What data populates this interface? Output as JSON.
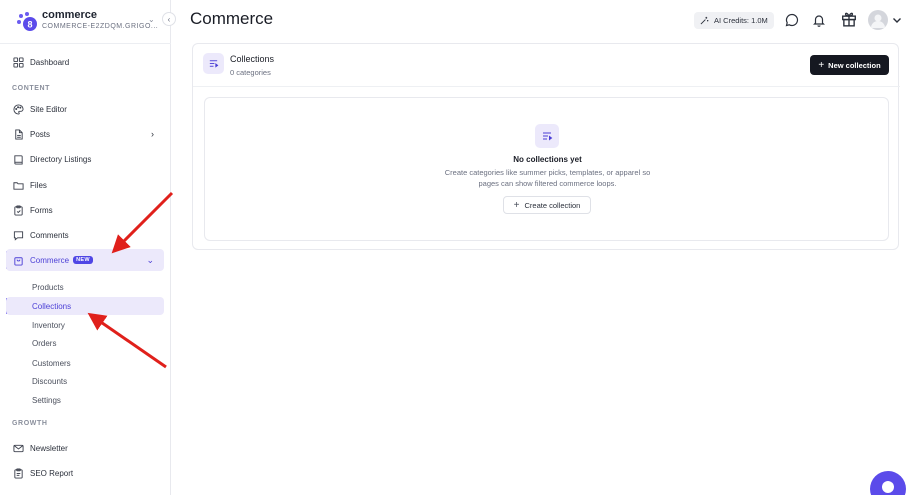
{
  "brand": {
    "name": "commerce",
    "subtitle": "COMMERCE-E2ZDQM.GRIGO...",
    "collapse_icon": "chevron-left-icon"
  },
  "sidebar": {
    "dashboard": "Dashboard",
    "content_label": "CONTENT",
    "site_editor": "Site Editor",
    "posts": "Posts",
    "directory_listings": "Directory Listings",
    "files": "Files",
    "forms": "Forms",
    "comments": "Comments",
    "commerce": "Commerce",
    "commerce_badge": "NEW",
    "commerce_sub": [
      "Products",
      "Collections",
      "Inventory",
      "Orders",
      "Customers",
      "Discounts",
      "Settings"
    ],
    "growth_label": "GROWTH",
    "newsletter": "Newsletter",
    "seo_report": "SEO Report"
  },
  "header": {
    "title": "Commerce",
    "ai_credits": "AI Credits: 1.0M"
  },
  "collections": {
    "title": "Collections",
    "count": "0 categories",
    "new_button": "New collection",
    "empty_title": "No collections yet",
    "empty_desc": "Create categories like summer picks, templates, or apparel so pages can show filtered commerce loops.",
    "create_button": "Create collection"
  },
  "colors": {
    "accent": "#5b4bea",
    "active_bg": "#ece9fb",
    "annotation_arrow": "#e0201b"
  }
}
